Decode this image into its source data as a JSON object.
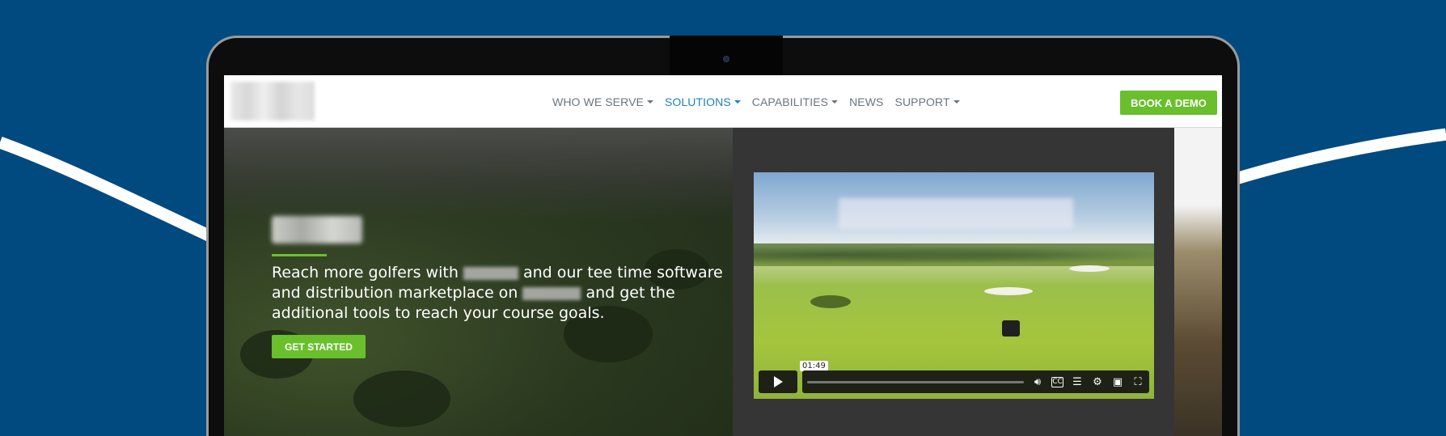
{
  "colors": {
    "background": "#004a80",
    "accent_green": "#6abf2d",
    "nav_active": "#1e7fc0",
    "nav_text": "#6b7480"
  },
  "nav": {
    "items": [
      {
        "label": "WHO WE SERVE",
        "dropdown": true,
        "active": false
      },
      {
        "label": "SOLUTIONS",
        "dropdown": true,
        "active": true
      },
      {
        "label": "CAPABILITIES",
        "dropdown": true,
        "active": false
      },
      {
        "label": "NEWS",
        "dropdown": false,
        "active": false
      },
      {
        "label": "SUPPORT",
        "dropdown": true,
        "active": false
      }
    ],
    "cta_label": "BOOK A DEMO"
  },
  "hero": {
    "text_part1": "Reach more golfers with ",
    "text_part2": " and our tee time software and distribution marketplace on ",
    "text_part3": " and get the additional tools to reach your course goals.",
    "cta_label": "GET STARTED"
  },
  "video": {
    "timecode": "01:49",
    "icons": [
      "play-icon",
      "volume-icon",
      "captions-icon",
      "transcript-icon",
      "settings-icon",
      "picture-in-picture-icon",
      "fullscreen-icon"
    ]
  }
}
